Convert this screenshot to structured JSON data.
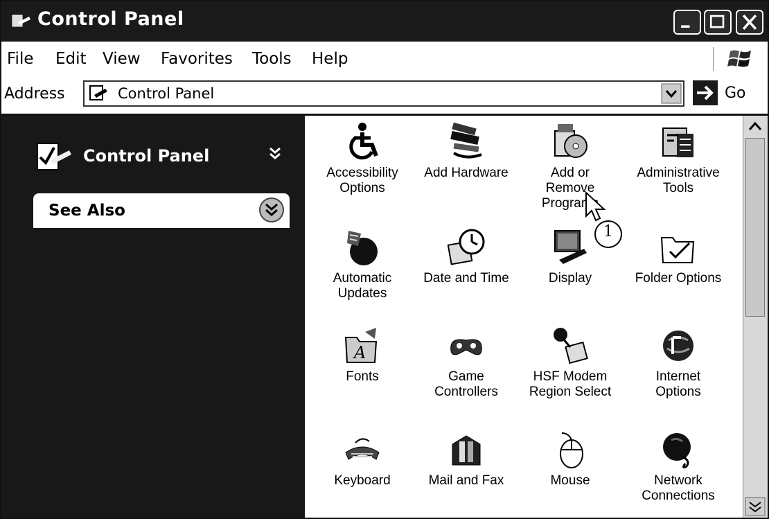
{
  "window": {
    "title": "Control Panel"
  },
  "menu": [
    "File",
    "Edit",
    "View",
    "Favorites",
    "Tools",
    "Help"
  ],
  "address": {
    "label": "Address",
    "value": "Control Panel",
    "go_label": "Go"
  },
  "taskpane": {
    "header_title": "Control Panel",
    "see_also_label": "See Also"
  },
  "items": [
    {
      "label": "Accessibility\nOptions",
      "icon": "accessibility-icon"
    },
    {
      "label": "Add Hardware",
      "icon": "add-hardware-icon"
    },
    {
      "label": "Add or\nRemove\nPrograms",
      "icon": "add-remove-programs-icon"
    },
    {
      "label": "Administrative\nTools",
      "icon": "administrative-tools-icon"
    },
    {
      "label": "Automatic\nUpdates",
      "icon": "automatic-updates-icon"
    },
    {
      "label": "Date and Time",
      "icon": "date-time-icon"
    },
    {
      "label": "Display",
      "icon": "display-icon"
    },
    {
      "label": "Folder Options",
      "icon": "folder-options-icon"
    },
    {
      "label": "Fonts",
      "icon": "fonts-icon"
    },
    {
      "label": "Game\nControllers",
      "icon": "game-controllers-icon"
    },
    {
      "label": "HSF Modem\nRegion Select",
      "icon": "hsf-modem-icon"
    },
    {
      "label": "Internet\nOptions",
      "icon": "internet-options-icon"
    },
    {
      "label": "Keyboard",
      "icon": "keyboard-icon"
    },
    {
      "label": "Mail and Fax",
      "icon": "mail-fax-icon"
    },
    {
      "label": "Mouse",
      "icon": "mouse-icon"
    },
    {
      "label": "Network\nConnections",
      "icon": "network-connections-icon"
    }
  ],
  "annotation": {
    "callout_number": "1"
  }
}
